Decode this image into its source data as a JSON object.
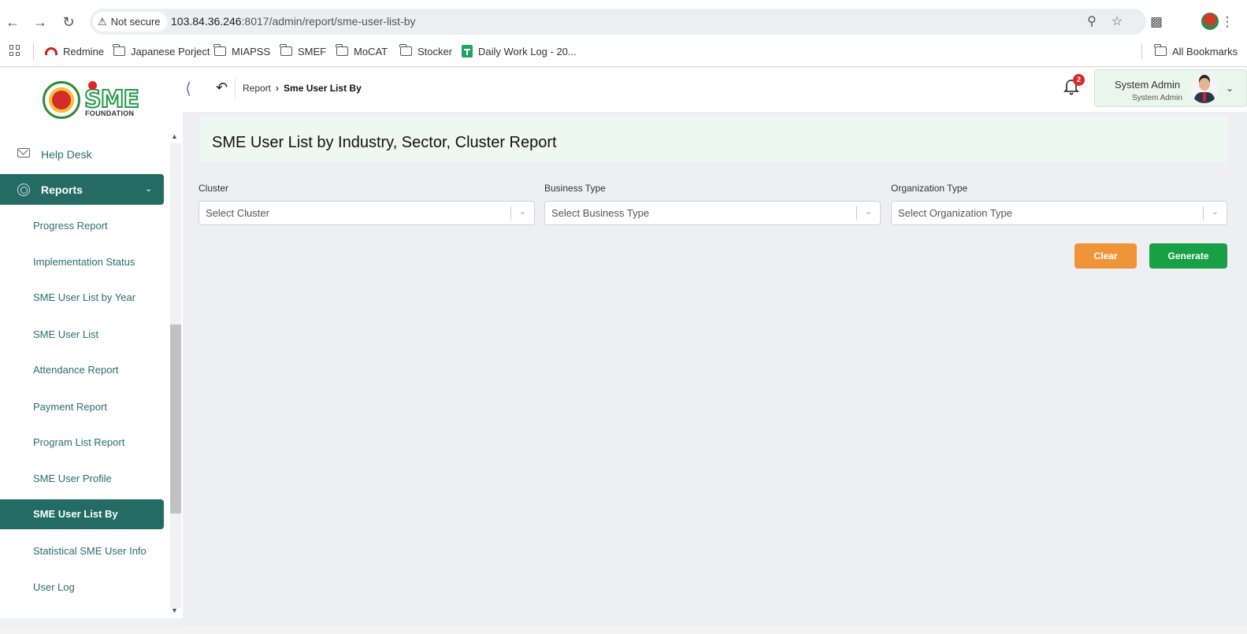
{
  "browser": {
    "security_label": "Not secure",
    "url_host": "103.84.36.246",
    "url_rest": ":8017/admin/report/sme-user-list-by",
    "bookmarks": [
      "Redmine",
      "Japanese Porject",
      "MIAPSS",
      "SMEF",
      "MoCAT",
      "Stocker",
      "Daily Work Log - 20..."
    ],
    "all_bookmarks": "All Bookmarks"
  },
  "logo": {
    "brand": "SME",
    "subtitle": "FOUNDATION"
  },
  "header": {
    "breadcrumb": [
      "Report",
      "Sme User List By"
    ],
    "notification_count": "2",
    "user_name": "System Admin",
    "user_role": "System Admin"
  },
  "sidebar": {
    "help_desk": "Help Desk",
    "reports": "Reports",
    "items": [
      {
        "label": "Progress Report"
      },
      {
        "label": "Implementation Status"
      },
      {
        "label": "SME User List by Year"
      },
      {
        "label": "SME User List"
      },
      {
        "label": "Attendance Report"
      },
      {
        "label": "Payment Report"
      },
      {
        "label": "Program List Report"
      },
      {
        "label": "SME User Profile"
      },
      {
        "label": "SME User List By"
      },
      {
        "label": "Statistical SME User Info"
      },
      {
        "label": "User Log"
      }
    ],
    "active_item": "SME User List By"
  },
  "main": {
    "title": "SME User List by Industry, Sector, Cluster Report",
    "filters": [
      {
        "label": "Cluster",
        "placeholder": "Select Cluster"
      },
      {
        "label": "Business Type",
        "placeholder": "Select Business Type"
      },
      {
        "label": "Organization Type",
        "placeholder": "Select Organization Type"
      }
    ],
    "clear_label": "Clear",
    "generate_label": "Generate"
  },
  "colors": {
    "primary": "#246b63",
    "clear": "#f0943a",
    "generate": "#17a046",
    "title_bg": "#eef8f2"
  }
}
